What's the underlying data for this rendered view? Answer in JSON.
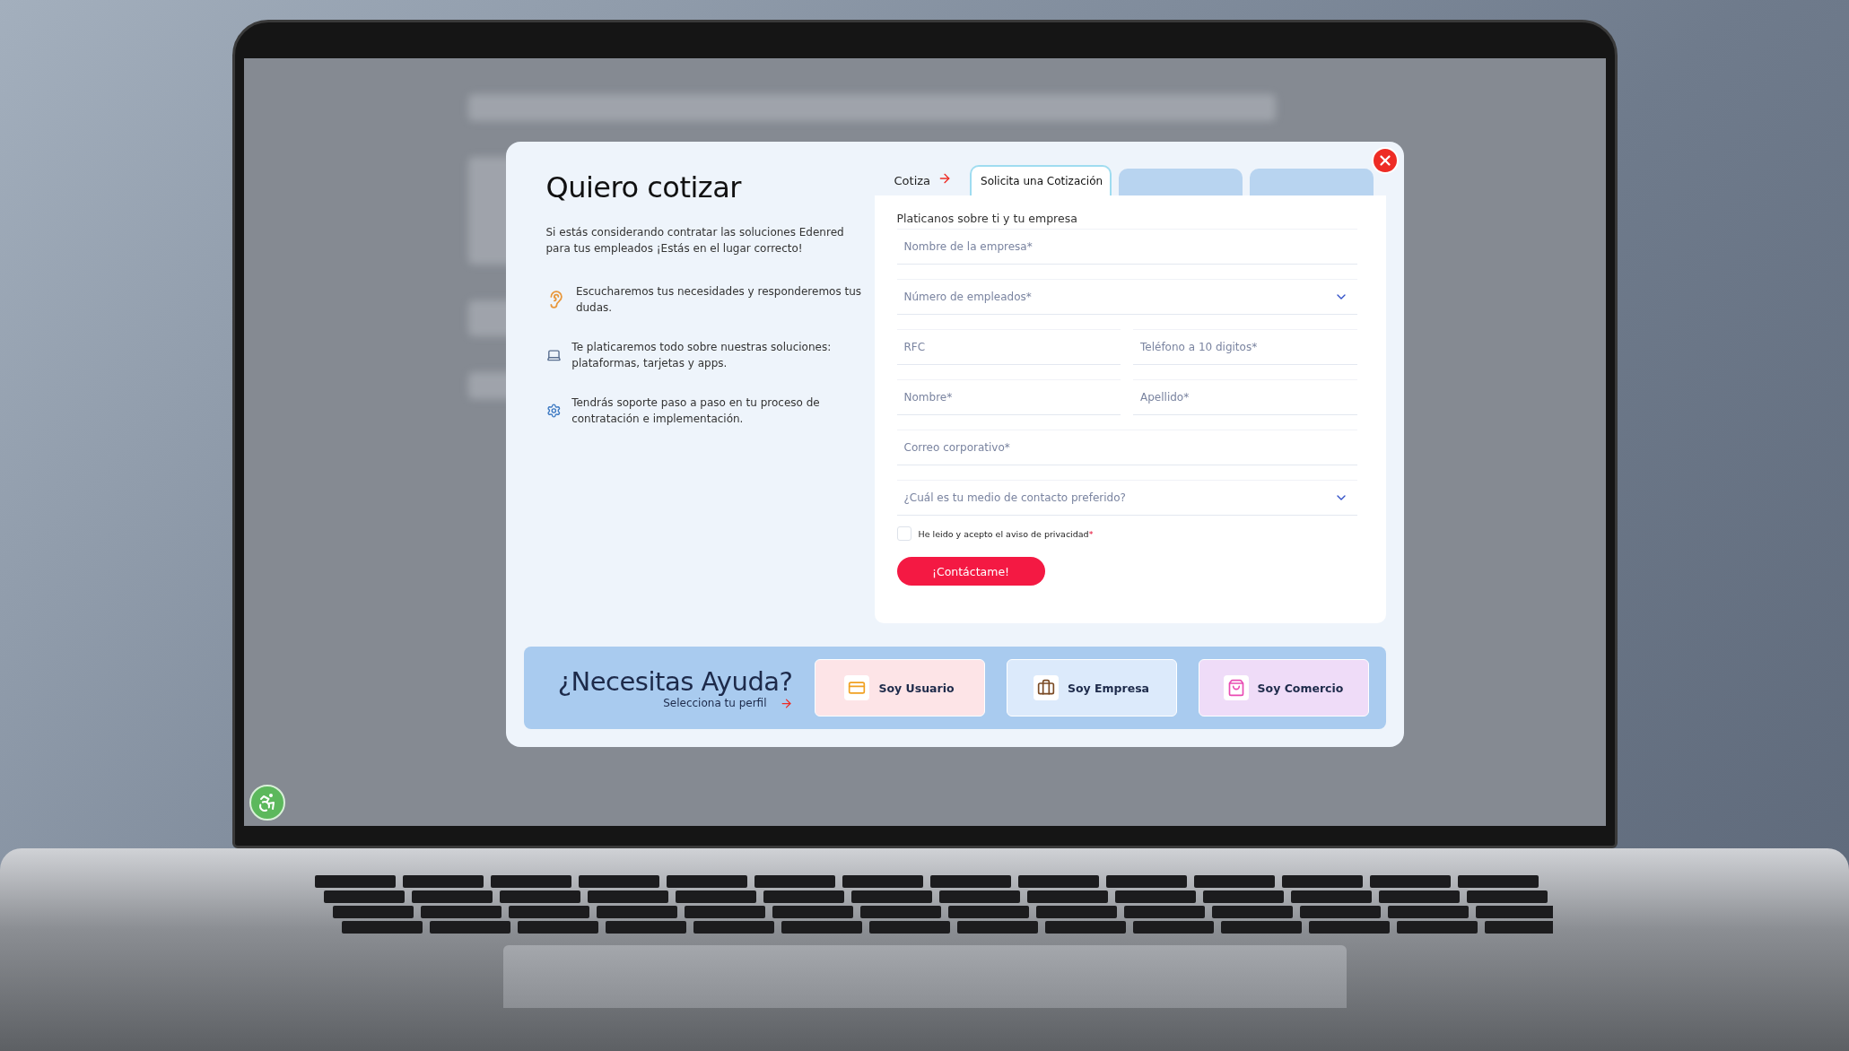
{
  "modal": {
    "title": "Quiero cotizar",
    "intro": "Si estás considerando contratar las soluciones Edenred para tus empleados ¡Estás en el lugar correcto!",
    "benefits": [
      {
        "kind": "listen",
        "text": "Escucharemos tus necesidades y responderemos tus dudas."
      },
      {
        "kind": "laptop",
        "text": "Te platicaremos todo sobre nuestras soluciones: plataformas, tarjetas y apps."
      },
      {
        "kind": "gear",
        "text": "Tendrás soporte paso a paso en tu proceso de contratación e implementación."
      }
    ],
    "steps": {
      "label": "Cotiza",
      "tabs": [
        {
          "label": "Solicita una Cotización",
          "selected": true
        },
        {
          "selected": false
        },
        {
          "selected": false
        }
      ]
    },
    "form": {
      "heading": "Platicanos sobre ti y tu empresa",
      "rows": [
        [
          {
            "kind": "text",
            "placeholder": "Nombre de la empresa*"
          }
        ],
        [
          {
            "kind": "select",
            "placeholder": "Número de empleados*"
          }
        ],
        [
          {
            "kind": "text",
            "placeholder": "RFC"
          },
          {
            "kind": "text",
            "placeholder": "Teléfono a 10 digitos*"
          }
        ],
        [
          {
            "kind": "text",
            "placeholder": "Nombre*"
          },
          {
            "kind": "text",
            "placeholder": "Apellido*"
          }
        ],
        [
          {
            "kind": "text",
            "placeholder": "Correo corporativo*"
          }
        ],
        [
          {
            "kind": "select",
            "placeholder": "¿Cuál es tu medio de contacto preferido?"
          }
        ]
      ],
      "consent": {
        "label": "He leido y acepto el aviso de privacidad",
        "mark": "*",
        "checked": false
      },
      "submit": "¡Contáctame!"
    },
    "help": {
      "title": "¿Necesitas Ayuda?",
      "subtitle": "Selecciona tu perfil",
      "profiles": [
        {
          "kind": "user",
          "label": "Soy Usuario",
          "color": "#fde4e7"
        },
        {
          "kind": "company",
          "label": "Soy Empresa",
          "color": "#dceafb"
        },
        {
          "kind": "shop",
          "label": "Soy Comercio",
          "color": "#efdcf8"
        }
      ]
    }
  }
}
